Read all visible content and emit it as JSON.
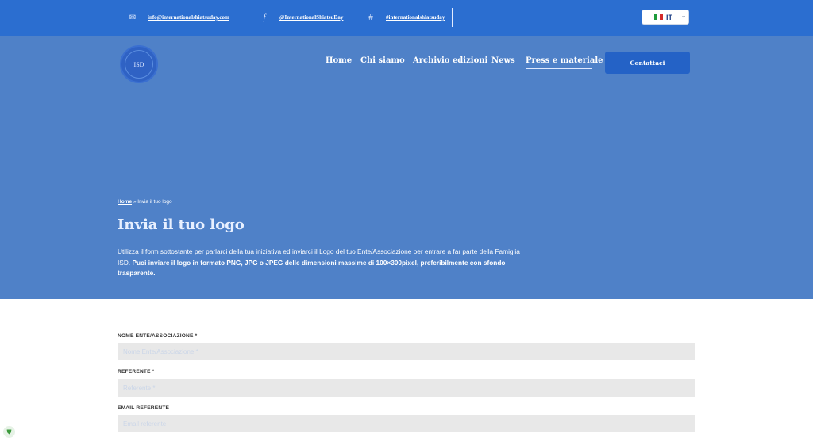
{
  "topbar": {
    "email": "info@internationalshiatsuday.com",
    "facebook": "@InternationalShiatsuDay",
    "hashtag": "#internationalshiatsuday",
    "language": "IT",
    "icons": {
      "email": "envelope-icon",
      "facebook": "facebook-icon",
      "hashtag": "hash-icon"
    }
  },
  "header": {
    "logo_text": "ISD",
    "nav": [
      "Home",
      "Chi siamo",
      "Archivio edizioni",
      "News",
      "Press e materiale"
    ],
    "active_nav": "Press e materiale",
    "cta": "Contattaci"
  },
  "hero": {
    "breadcrumb_home": "Home",
    "breadcrumb_sep": " » ",
    "breadcrumb_current": "Invia il tuo logo",
    "title": "Invia il tuo logo",
    "desc_normal": "Utilizza il form sottostante per parlarci della tua iniziativa ed inviarci il Logo del tuo Ente/Associazione per entrare a far parte della Famiglia ISD. ",
    "desc_bold": "Puoi inviare il logo in formato PNG, JPG o JPEG delle dimensioni massime di 100×300pixel, preferibilmente con sfondo trasparente."
  },
  "form": {
    "fields": [
      {
        "label": "NOME ENTE/ASSOCIAZIONE",
        "required": "*",
        "placeholder": "Nome Ente/Associazione *"
      },
      {
        "label": "REFERENTE",
        "required": "*",
        "placeholder": "Referente *"
      },
      {
        "label": "EMAIL REFERENTE",
        "required": "",
        "placeholder": "Email referente"
      }
    ]
  },
  "colors": {
    "topbar": "#2b6ed0",
    "hero": "#4f81c8",
    "cta": "#2462c6",
    "input_bg": "#e8e8e8"
  }
}
